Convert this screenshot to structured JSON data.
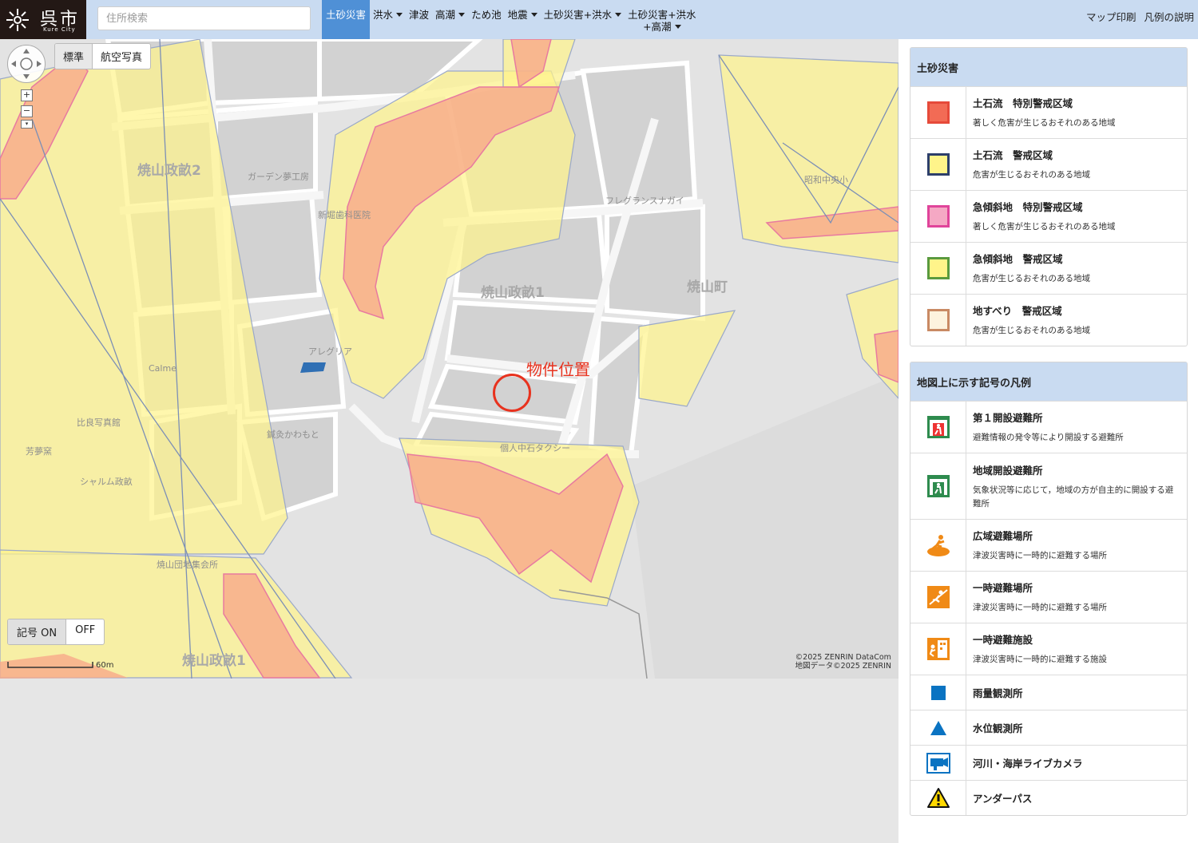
{
  "header": {
    "logo": {
      "name": "呉市",
      "sub": "Kure City"
    },
    "search_placeholder": "住所検索",
    "nav": [
      {
        "label": "土砂災害",
        "caret": false,
        "active": true
      },
      {
        "label": "洪水",
        "caret": true
      },
      {
        "label": "津波",
        "caret": false
      },
      {
        "label": "高潮",
        "caret": true
      },
      {
        "label": "ため池",
        "caret": false
      },
      {
        "label": "地震",
        "caret": true
      },
      {
        "label": "土砂災害+洪水",
        "caret": true
      },
      {
        "label": "土砂災害+洪水",
        "label2": "+高潮",
        "caret": true
      }
    ],
    "right_links": [
      "マップ印刷",
      "凡例の説明"
    ]
  },
  "map": {
    "basemap": [
      "標準",
      "航空写真"
    ],
    "symbol_toggle": [
      "記号 ON",
      "OFF"
    ],
    "property_label": "物件位置",
    "scale": "60m",
    "credit": [
      "©2025 ZENRIN DataCom",
      "地図データ©2025 ZENRIN"
    ],
    "areas": [
      "焼山政畝2",
      "焼山政畝1",
      "焼山町",
      "焼山政畝1"
    ],
    "places": [
      "ガーデン夢工房",
      "新堀歯科医院",
      "フレグランスナガイ",
      "昭和中央小",
      "アレグリア",
      "Calme",
      "比良写真館",
      "芳夢窯",
      "シャルム政畝",
      "鍼灸かわもと",
      "個人中石タクシー",
      "焼山団地集会所"
    ]
  },
  "legend": {
    "groups": [
      {
        "title": "土砂災害",
        "items": [
          {
            "title": "土石流　特別警戒区域",
            "desc": "著しく危害が生じるおそれのある地域",
            "fill": "#f26b55",
            "border": "#e64a3a"
          },
          {
            "title": "土石流　警戒区域",
            "desc": "危害が生じるおそれのある地域",
            "fill": "#fff48a",
            "border": "#2d3f6a"
          },
          {
            "title": "急傾斜地　特別警戒区域",
            "desc": "著しく危害が生じるおそれのある地域",
            "fill": "#f5a8c4",
            "border": "#e0449a"
          },
          {
            "title": "急傾斜地　警戒区域",
            "desc": "危害が生じるおそれのある地域",
            "fill": "#fff48a",
            "border": "#5a9a3e"
          },
          {
            "title": "地すべり　警戒区域",
            "desc": "危害が生じるおそれのある地域",
            "fill": "#fdf3de",
            "border": "#c98a64"
          }
        ]
      },
      {
        "title": "地図上に示す記号の凡例",
        "items": [
          {
            "title": "第１開設避難所",
            "desc": "避難情報の発令等により開設する避難所",
            "icon": "shelter-red-icon"
          },
          {
            "title": "地域開設避難所",
            "desc": "気象状況等に応じて，地域の方が自主的に開設する避難所",
            "icon": "shelter-green-icon"
          },
          {
            "title": "広域避難場所",
            "desc": "津波災害時に一時的に避難する場所",
            "icon": "wide-evacuation-icon"
          },
          {
            "title": "一時避難場所",
            "desc": "津波災害時に一時的に避難する場所",
            "icon": "temporary-evacuation-site-icon"
          },
          {
            "title": "一時避難施設",
            "desc": "津波災害時に一時的に避難する施設",
            "icon": "temporary-evacuation-building-icon"
          },
          {
            "title": "雨量観測所",
            "desc": "",
            "icon": "rain-gauge-icon"
          },
          {
            "title": "水位観測所",
            "desc": "",
            "icon": "water-level-icon"
          },
          {
            "title": "河川・海岸ライブカメラ",
            "desc": "",
            "icon": "live-camera-icon"
          },
          {
            "title": "アンダーパス",
            "desc": "",
            "icon": "underpass-warning-icon"
          }
        ]
      }
    ]
  },
  "colors": {
    "header_bg": "#c9dbf1",
    "active_tab": "#4f90d6",
    "property_marker": "#e8321e",
    "hazard_yellow": "#fff48a",
    "hazard_red": "#f26b55"
  }
}
